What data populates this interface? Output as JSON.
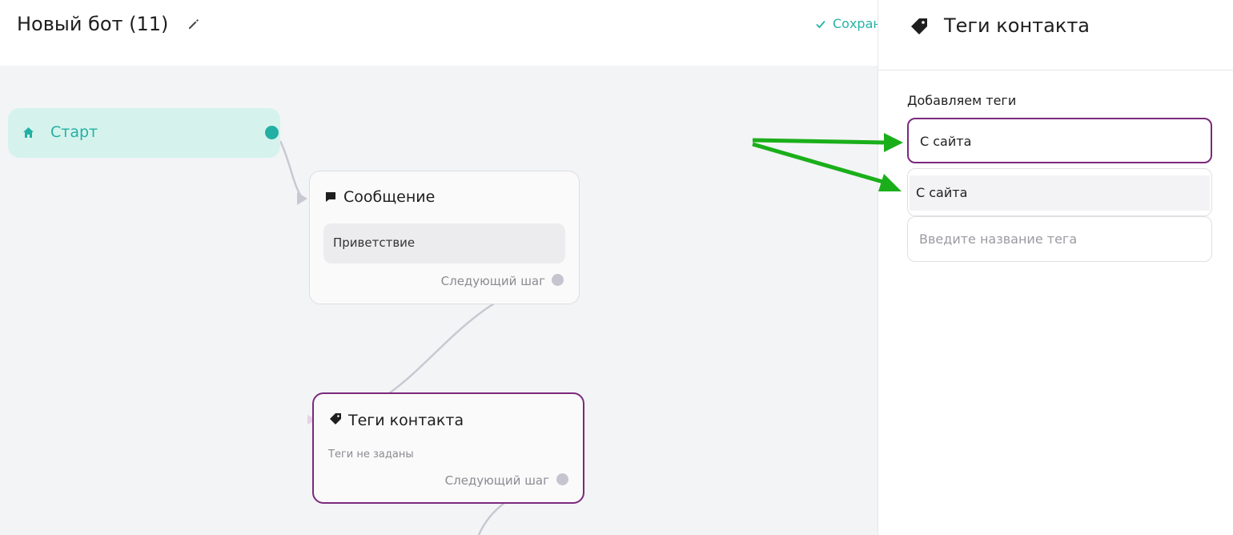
{
  "header": {
    "bot_title": "Новый бот (11)",
    "save_status": "Сохранено"
  },
  "canvas": {
    "start_node": {
      "label": "Старт"
    },
    "message_node": {
      "title": "Сообщение",
      "message": "Приветствие",
      "next_step": "Следующий шаг"
    },
    "tags_node": {
      "title": "Теги контакта",
      "empty_text": "Теги не заданы",
      "next_step": "Следующий шаг"
    }
  },
  "panel": {
    "title": "Теги контакта",
    "section_label": "Добавляем теги",
    "tag_input_value": "С сайта",
    "suggestion": "С сайта",
    "new_tag_placeholder": "Введите название тега"
  },
  "colors": {
    "accent_teal": "#23b0a4",
    "accent_purple": "#7b2a7b",
    "annotation_arrow": "#1aaf1a"
  },
  "icons": {
    "edit": "pencil-icon",
    "save": "check-icon",
    "start": "home-icon",
    "message": "chat-bubble-icon",
    "tags": "tag-icon"
  }
}
